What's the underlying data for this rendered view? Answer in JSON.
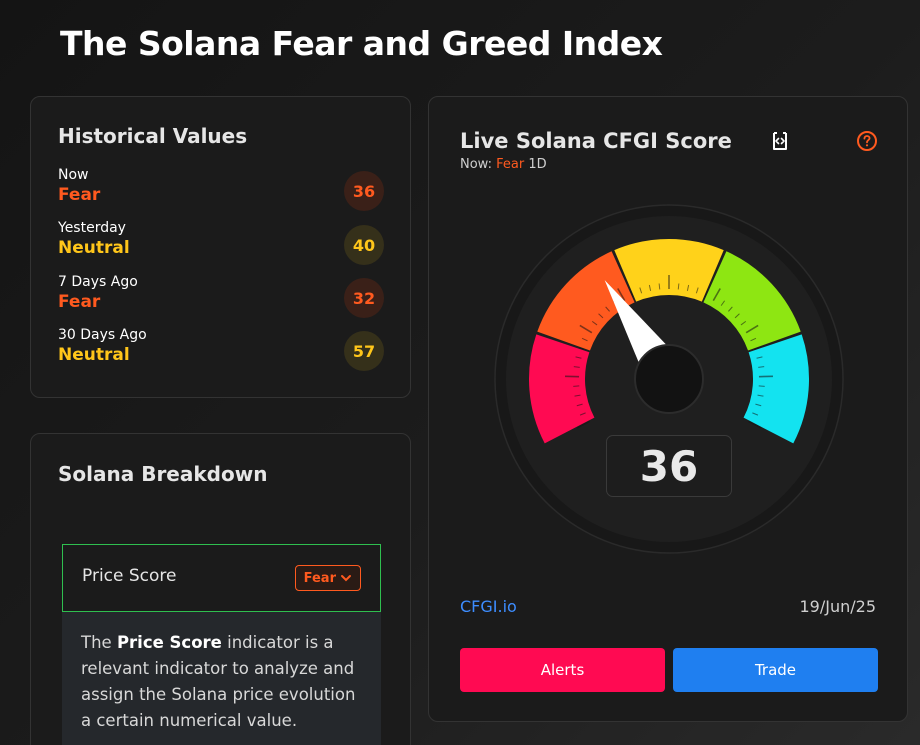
{
  "page": {
    "title": "The Solana Fear and Greed Index"
  },
  "historical": {
    "title": "Historical Values",
    "rows": [
      {
        "label": "Now",
        "status": "Fear",
        "value": "36",
        "tone": "fear"
      },
      {
        "label": "Yesterday",
        "status": "Neutral",
        "value": "40",
        "tone": "neutral"
      },
      {
        "label": "7 Days Ago",
        "status": "Fear",
        "value": "32",
        "tone": "fear"
      },
      {
        "label": "30 Days Ago",
        "status": "Neutral",
        "value": "57",
        "tone": "neutral"
      }
    ]
  },
  "breakdown": {
    "title": "Solana Breakdown",
    "price_score_label": "Price Score",
    "price_score_status": "Fear",
    "description_pre": "The ",
    "description_bold": "Price Score",
    "description_post": " indicator is a relevant indicator to analyze and assign the Solana price evolution a certain numerical value."
  },
  "live": {
    "title": "Live Solana CFGI Score",
    "now_prefix": "Now: ",
    "now_status": "Fear",
    "timeframe": "1D",
    "score": "36",
    "score_value": 36,
    "source_link": "CFGI.io",
    "date": "19/Jun/25",
    "alerts_label": "Alerts",
    "trade_label": "Trade",
    "icons": {
      "embed": "code-embed-icon",
      "help": "help-circle-icon"
    }
  },
  "colors": {
    "fear": "#ff5a1f",
    "neutral": "#ffc61a",
    "link": "#3d8dff",
    "alerts_button": "#ff0a52",
    "trade_button": "#1f7ff0",
    "gauge_segments": [
      "#ff0a52",
      "#ff5a1f",
      "#ffd21a",
      "#8ee612",
      "#13e3f0"
    ]
  }
}
